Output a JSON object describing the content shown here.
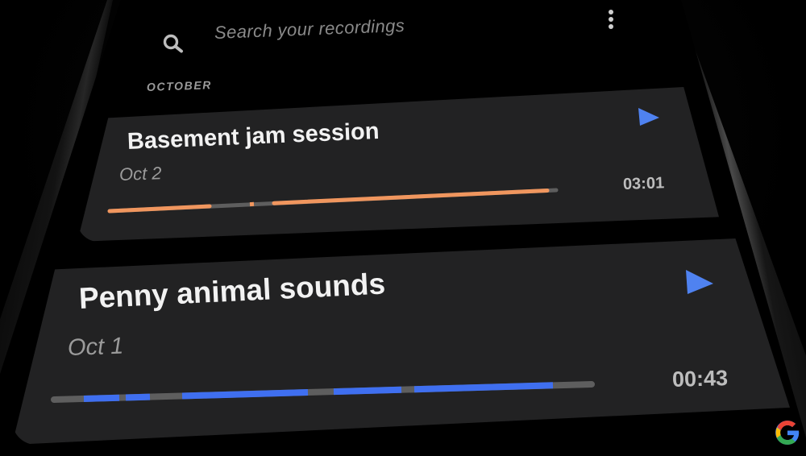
{
  "search": {
    "placeholder": "Search your recordings",
    "icon": "search-icon"
  },
  "menu": {
    "icon": "more-vert-icon"
  },
  "section": {
    "label": "OCTOBER"
  },
  "recordings": [
    {
      "title": "Basement jam session",
      "date": "Oct 2",
      "duration": "03:01",
      "accent_color": "#f0965e",
      "play_icon": "play-icon",
      "play_color": "#4f82f0"
    },
    {
      "title": "Penny animal sounds",
      "date": "Oct 1",
      "duration": "00:43",
      "accent_color": "#3f6ff0",
      "play_icon": "play-icon",
      "play_color": "#4f82f0"
    }
  ],
  "branding": {
    "logo": "google-g-logo"
  }
}
